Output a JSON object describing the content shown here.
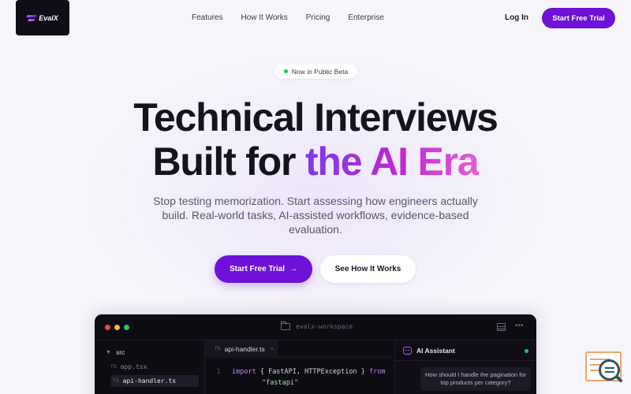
{
  "brand": {
    "name": "EvalX"
  },
  "nav": {
    "links": [
      "Features",
      "How It Works",
      "Pricing",
      "Enterprise"
    ],
    "login": "Log In",
    "cta": "Start Free Trial"
  },
  "hero": {
    "badge": "Now in Public Beta",
    "title_line1": "Technical Interviews",
    "title_line2_plain": "Built for ",
    "title_line2_accent": "the AI Era",
    "subtitle": "Stop testing memorization. Start assessing how engineers actually build. Real-world tasks, AI-assisted workflows, evidence-based evaluation.",
    "primary_cta": "Start Free Trial",
    "primary_cta_arrow": "→",
    "secondary_cta": "See How It Works"
  },
  "ide": {
    "workspace": "evalx-workspace",
    "explorer": {
      "folder": "src",
      "files": [
        {
          "label": "TS",
          "name": "app.tsx",
          "active": false
        },
        {
          "label": "TS",
          "name": "api-handler.ts",
          "active": true
        }
      ]
    },
    "tab": {
      "label": "TS",
      "name": "api-handler.ts",
      "close": "×"
    },
    "code": [
      {
        "ln": "1",
        "kw": "import",
        "text": " { FastAPI, HTTPException } ",
        "kw2": "from"
      },
      {
        "ln": "",
        "str": "\"fastapi\""
      }
    ],
    "assistant": {
      "title": "AI Assistant",
      "message": "How should I handle the pagination for top products per category?"
    }
  },
  "colors": {
    "accent": "#6d12d6",
    "gradient_start": "#7c3aed",
    "gradient_end": "#e45fd6",
    "status_online": "#22c55e"
  }
}
